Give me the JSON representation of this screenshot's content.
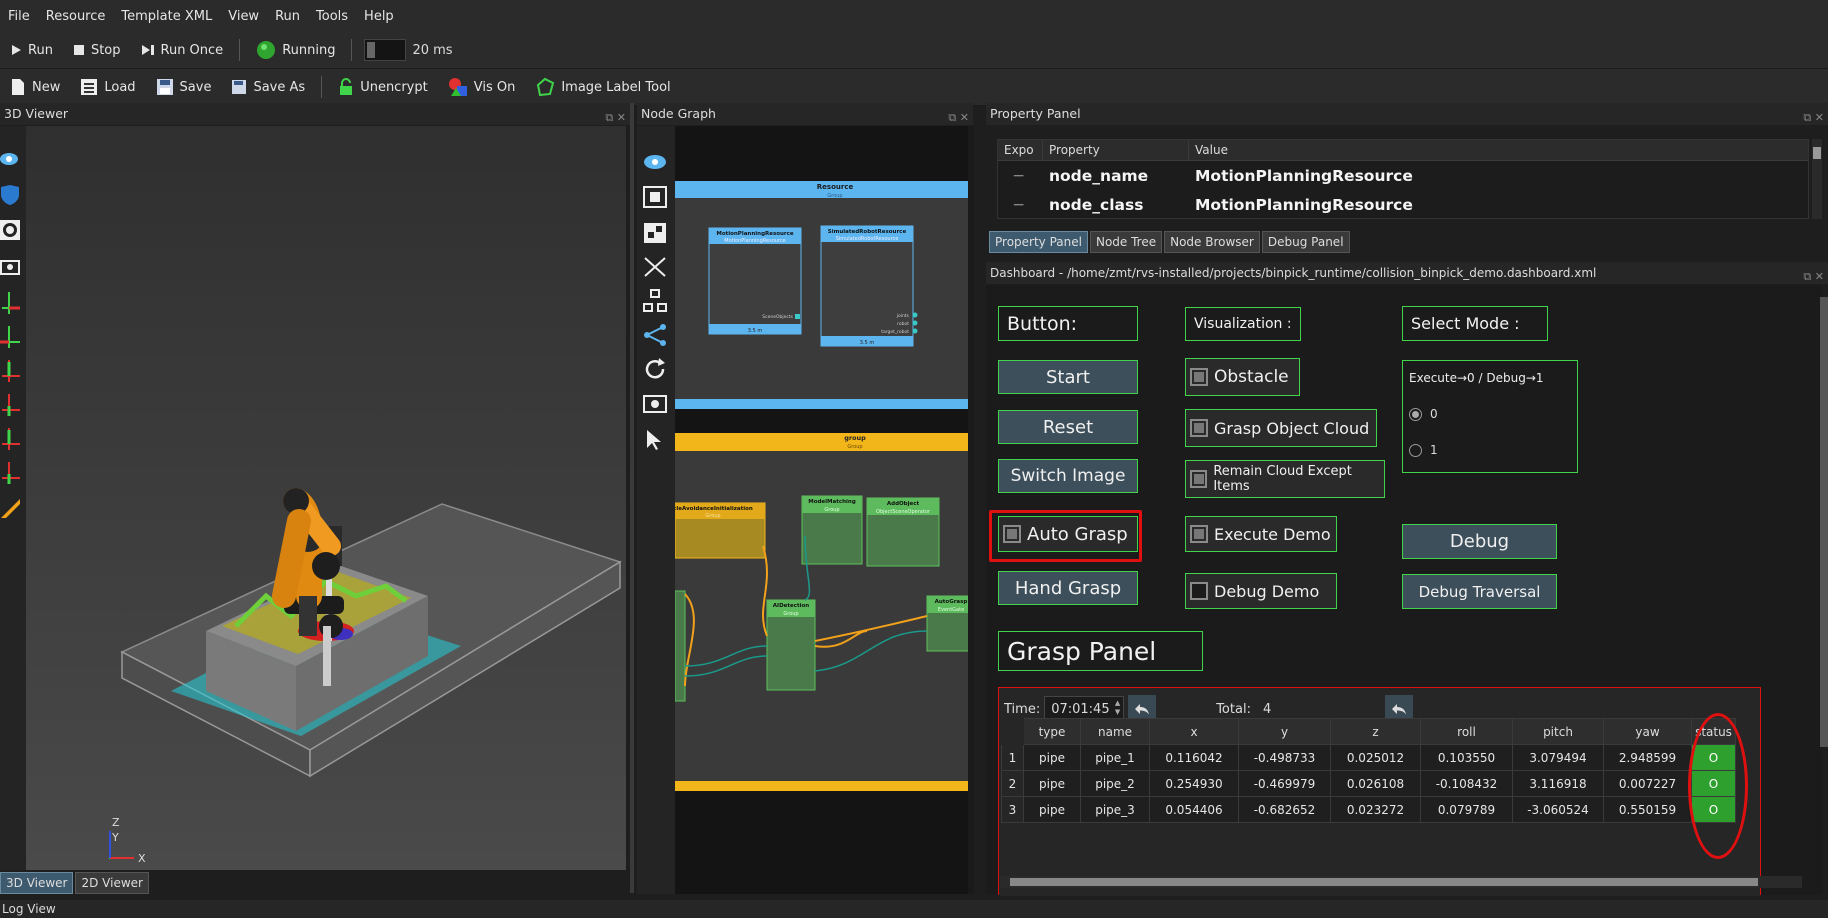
{
  "menu": [
    "File",
    "Resource",
    "Template XML",
    "View",
    "Run",
    "Tools",
    "Help"
  ],
  "toolbar1": {
    "run": "Run",
    "stop": "Stop",
    "run_once": "Run Once",
    "running": "Running",
    "interval": "20 ms"
  },
  "toolbar2": {
    "new": "New",
    "load": "Load",
    "save": "Save",
    "save_as": "Save As",
    "unencrypt": "Unencrypt",
    "vis_on": "Vis On",
    "image_label_tool": "Image Label Tool"
  },
  "viewer": {
    "title": "3D Viewer",
    "tabs": [
      "3D Viewer",
      "2D Viewer"
    ],
    "axis_z": "Z",
    "axis_y": "Y",
    "axis_x": "X",
    "side_icons": [
      "eye-icon",
      "shield-icon",
      "target-icon",
      "camera-icon",
      "+X",
      "-X",
      "+Y",
      "-Y",
      "+Z",
      "-Z",
      "ruler-icon"
    ]
  },
  "node_graph": {
    "title": "Node Graph",
    "resource_group": {
      "title": "Resource",
      "sub": "Group"
    },
    "nodes": [
      {
        "title": "MotionPlanningResource",
        "sub": "MotionPlanningResource",
        "port": "SceneObjects",
        "foot": "3.5 m"
      },
      {
        "title": "SimulatedRobotResource",
        "sub": "SimulatedRobotResource",
        "ports": [
          "joints",
          "robot",
          "target_robot"
        ],
        "foot": "3.5 m"
      }
    ],
    "group": {
      "title": "group",
      "sub": "Group"
    },
    "inner_nodes": [
      {
        "title": "cleAvoidanceInitialization",
        "sub": "Group"
      },
      {
        "title": "ModelMatching",
        "sub": "Group"
      },
      {
        "title": "AddObject",
        "sub": "ObjectSceneOperator"
      },
      {
        "title": "AIDetection",
        "sub": "Group"
      },
      {
        "title": "AutoGrasp",
        "sub": "EventGate"
      }
    ]
  },
  "property_panel": {
    "title": "Property Panel",
    "headers": [
      "Expo",
      "Property",
      "Value"
    ],
    "rows": [
      {
        "property": "node_name",
        "value": "MotionPlanningResource"
      },
      {
        "property": "node_class",
        "value": "MotionPlanningResource"
      }
    ],
    "tabs": [
      "Property Panel",
      "Node Tree",
      "Node Browser",
      "Debug Panel"
    ]
  },
  "dashboard": {
    "title": "Dashboard - /home/zmt/rvs-installed/projects/binpick_runtime/collision_binpick_demo.dashboard.xml",
    "button_label": "Button:",
    "buttons": [
      "Start",
      "Reset",
      "Switch Image"
    ],
    "auto_grasp": "Auto Grasp",
    "hand_grasp": "Hand Grasp",
    "visualization_label": "Visualization :",
    "checkboxes": [
      "Obstacle",
      "Grasp Object Cloud",
      "Remain Cloud Except Items",
      "Execute Demo",
      "Debug Demo"
    ],
    "select_mode_label": "Select Mode :",
    "mode_group_title": "Execute→0 / Debug→1",
    "mode_options": [
      "0",
      "1"
    ],
    "debug": "Debug",
    "debug_traversal": "Debug Traversal",
    "grasp_panel": "Grasp Panel",
    "time_label": "Time:",
    "time_value": "07:01:45",
    "total_label": "Total:",
    "total_value": "4",
    "table": {
      "headers": [
        "type",
        "name",
        "x",
        "y",
        "z",
        "roll",
        "pitch",
        "yaw",
        "status"
      ],
      "rows": [
        [
          "1",
          "pipe",
          "pipe_1",
          "0.116042",
          "-0.498733",
          "0.025012",
          "0.103550",
          "3.079494",
          "2.948599",
          "O"
        ],
        [
          "2",
          "pipe",
          "pipe_2",
          "0.254930",
          "-0.469979",
          "0.026108",
          "-0.108432",
          "3.116918",
          "0.007227",
          "O"
        ],
        [
          "3",
          "pipe",
          "pipe_3",
          "0.054406",
          "-0.682652",
          "0.023272",
          "0.079789",
          "-3.060524",
          "0.550159",
          "O"
        ]
      ]
    }
  },
  "log_view": {
    "title": "Log View"
  },
  "colors": {
    "green": "#3fd44a",
    "highlight": "#e01010",
    "status": "#2ea02e",
    "orange": "#f2a11a",
    "blue": "#5db5f0"
  }
}
